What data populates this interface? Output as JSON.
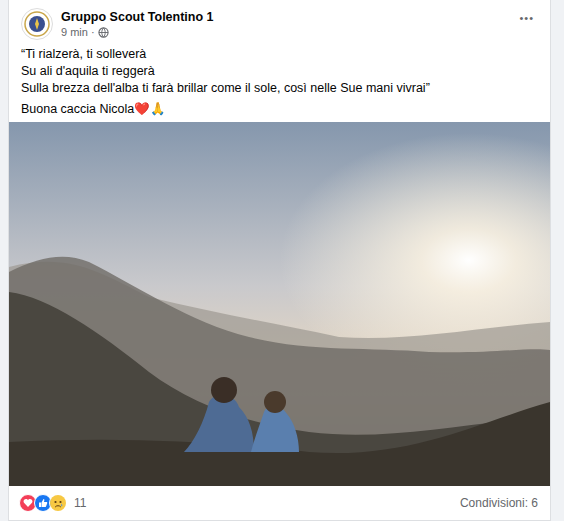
{
  "post": {
    "author": "Gruppo Scout Tolentino 1",
    "time": "9 min",
    "separator": "·",
    "menu": "•••",
    "caption_lines": [
      "“Ti rialzerà, ti solleverà",
      "Su ali d'aquila ti reggerà",
      "Sulla brezza dell'alba ti farà brillar come il sole, così nelle Sue mani vivrai”"
    ],
    "closing": "Buona caccia Nicola❤️🙏"
  },
  "reactions": {
    "count": "11"
  },
  "shares": "Condivisioni: 6"
}
